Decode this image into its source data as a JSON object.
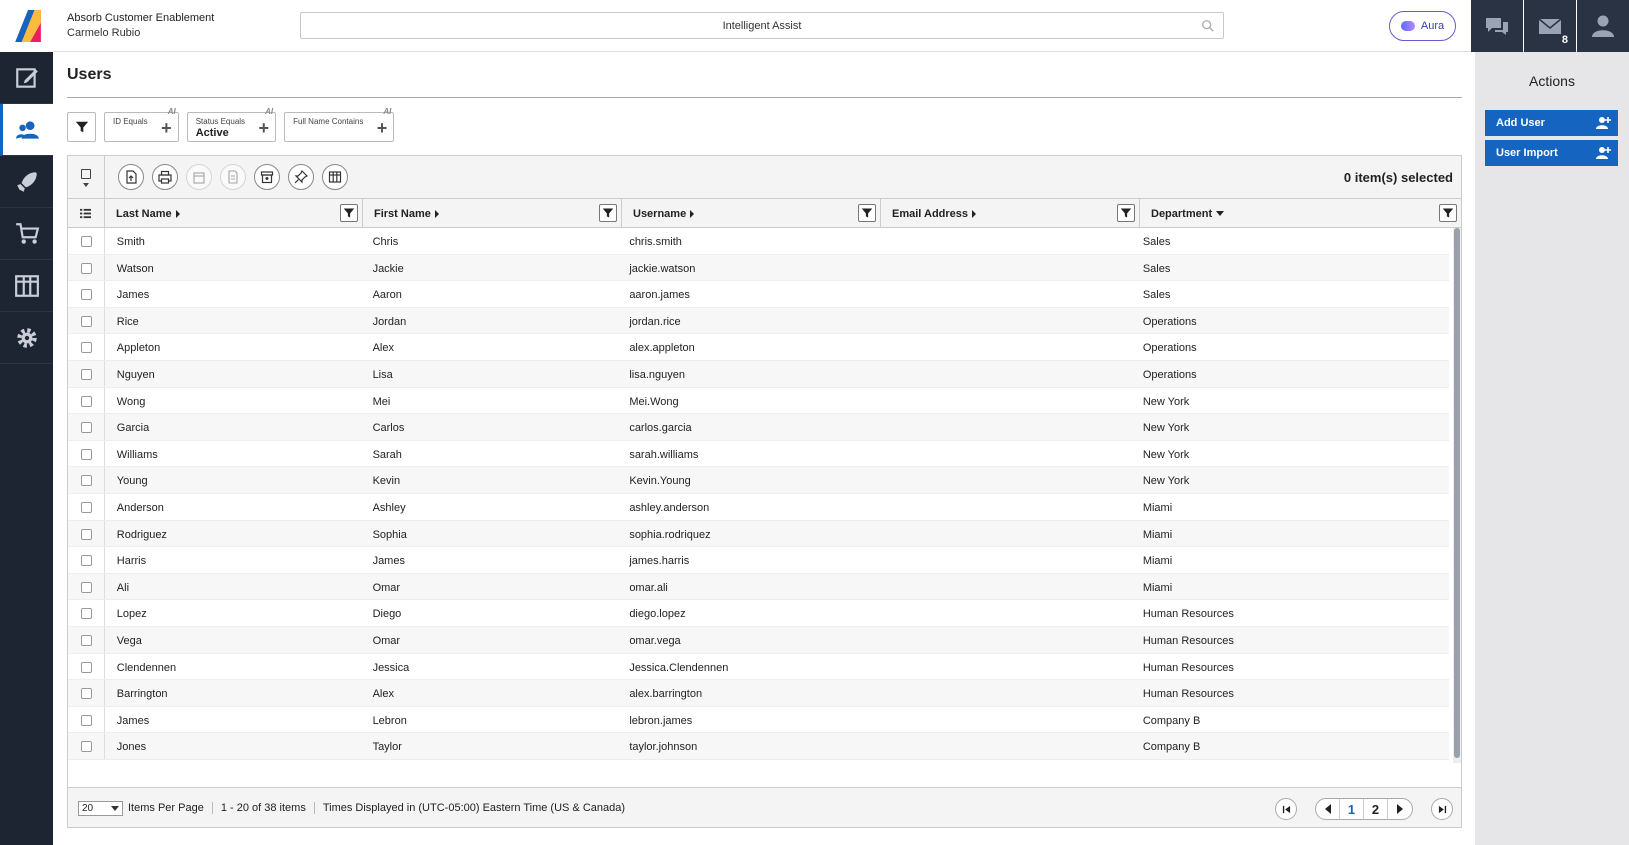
{
  "header": {
    "org_name": "Absorb Customer Enablement",
    "user_name": "Carmelo Rubio",
    "search_placeholder": "Intelligent Assist",
    "aura_label": "Aura",
    "messages_count": "8"
  },
  "page": {
    "title": "Users"
  },
  "filters": [
    {
      "title": "ID Equals",
      "value": "",
      "ai": "AI"
    },
    {
      "title": "Status Equals",
      "value": "Active",
      "ai": "AI"
    },
    {
      "title": "Full Name Contains",
      "value": "",
      "ai": "AI"
    }
  ],
  "toolbar": {
    "selected_text": "0 item(s) selected",
    "buttons": [
      "export-icon",
      "print-icon",
      "calendar-icon",
      "report-icon",
      "archive-icon",
      "pin-icon",
      "columns-icon"
    ]
  },
  "columns": [
    {
      "label": "Last Name",
      "sort": "right"
    },
    {
      "label": "First Name",
      "sort": "right"
    },
    {
      "label": "Username",
      "sort": "right"
    },
    {
      "label": "Email Address",
      "sort": "right"
    },
    {
      "label": "Department",
      "sort": "down"
    }
  ],
  "rows": [
    [
      "Smith",
      "Chris",
      "chris.smith",
      "",
      "Sales"
    ],
    [
      "Watson",
      "Jackie",
      "jackie.watson",
      "",
      "Sales"
    ],
    [
      "James",
      "Aaron",
      "aaron.james",
      "",
      "Sales"
    ],
    [
      "Rice",
      "Jordan",
      "jordan.rice",
      "",
      "Operations"
    ],
    [
      "Appleton",
      "Alex",
      "alex.appleton",
      "",
      "Operations"
    ],
    [
      "Nguyen",
      "Lisa",
      "lisa.nguyen",
      "",
      "Operations"
    ],
    [
      "Wong",
      "Mei",
      "Mei.Wong",
      "",
      "New York"
    ],
    [
      "Garcia",
      "Carlos",
      "carlos.garcia",
      "",
      "New York"
    ],
    [
      "Williams",
      "Sarah",
      "sarah.williams",
      "",
      "New York"
    ],
    [
      "Young",
      "Kevin",
      "Kevin.Young",
      "",
      "New York"
    ],
    [
      "Anderson",
      "Ashley",
      "ashley.anderson",
      "",
      "Miami"
    ],
    [
      "Rodriguez",
      "Sophia",
      "sophia.rodriquez",
      "",
      "Miami"
    ],
    [
      "Harris",
      "James",
      "james.harris",
      "",
      "Miami"
    ],
    [
      "Ali",
      "Omar",
      "omar.ali",
      "",
      "Miami"
    ],
    [
      "Lopez",
      "Diego",
      "diego.lopez",
      "",
      "Human Resources"
    ],
    [
      "Vega",
      "Omar",
      "omar.vega",
      "",
      "Human Resources"
    ],
    [
      "Clendennen",
      "Jessica",
      "Jessica.Clendennen",
      "",
      "Human Resources"
    ],
    [
      "Barrington",
      "Alex",
      "alex.barrington",
      "",
      "Human Resources"
    ],
    [
      "James",
      "Lebron",
      "lebron.james",
      "",
      "Company B"
    ],
    [
      "Jones",
      "Taylor",
      "taylor.johnson",
      "",
      "Company B"
    ]
  ],
  "footer": {
    "per_page": "20",
    "per_page_label": "Items Per Page",
    "range": "1 - 20 of 38 items",
    "timezone": "Times Displayed in (UTC-05:00) Eastern Time (US & Canada)",
    "pages": [
      "1",
      "2"
    ],
    "current_page": "1"
  },
  "actions": {
    "title": "Actions",
    "add_user": "Add User",
    "user_import": "User Import"
  },
  "colors": {
    "accent": "#1565c0",
    "rail": "#1d2533"
  }
}
